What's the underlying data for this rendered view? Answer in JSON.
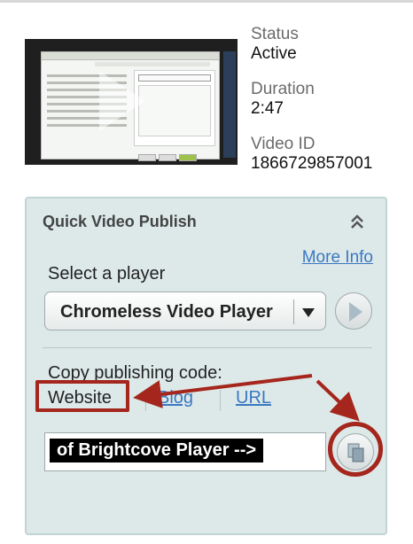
{
  "video": {
    "status_label": "Status",
    "status_value": "Active",
    "duration_label": "Duration",
    "duration_value": "2:47",
    "id_label": "Video ID",
    "id_value": "1866729857001"
  },
  "panel": {
    "title": "Quick Video Publish",
    "collapse_icon": "double-chevron-up-icon",
    "more_info": "More Info",
    "select_label": "Select a player",
    "player_selected": "Chromeless Video Player",
    "copy_label": "Copy publishing code:",
    "tabs": [
      {
        "label": "Website",
        "active": true
      },
      {
        "label": "Blog",
        "active": false
      },
      {
        "label": "URL",
        "active": false
      }
    ],
    "code_value": " of Brightcove Player -->"
  },
  "colors": {
    "panel_bg": "#dde9e9",
    "link": "#3a78c2",
    "annotation": "#a5261c"
  }
}
